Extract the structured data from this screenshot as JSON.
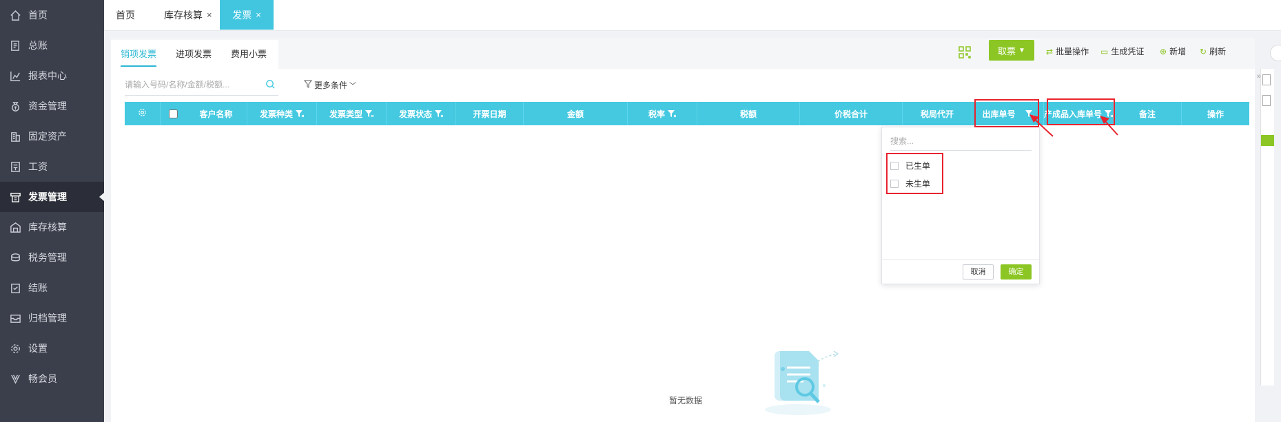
{
  "sidebar": {
    "items": [
      {
        "label": "首页",
        "icon": "home-icon"
      },
      {
        "label": "总账",
        "icon": "ledger-icon"
      },
      {
        "label": "报表中心",
        "icon": "chart-icon"
      },
      {
        "label": "资金管理",
        "icon": "money-bag-icon"
      },
      {
        "label": "固定资产",
        "icon": "building-icon"
      },
      {
        "label": "工资",
        "icon": "payroll-icon"
      },
      {
        "label": "发票管理",
        "icon": "invoice-icon"
      },
      {
        "label": "库存核算",
        "icon": "warehouse-icon"
      },
      {
        "label": "税务管理",
        "icon": "tax-icon"
      },
      {
        "label": "结账",
        "icon": "checkout-icon"
      },
      {
        "label": "归档管理",
        "icon": "archive-icon"
      },
      {
        "label": "设置",
        "icon": "gear-icon"
      },
      {
        "label": "畅会员",
        "icon": "vip-icon"
      }
    ],
    "active_index": 6
  },
  "tabs": [
    {
      "label": "首页"
    },
    {
      "label": "库存核算",
      "close": "×"
    },
    {
      "label": "发票",
      "close": "×"
    }
  ],
  "subtabs": [
    {
      "label": "销项发票"
    },
    {
      "label": "进项发票"
    },
    {
      "label": "费用小票"
    }
  ],
  "toolbar": {
    "fetch_label": "取票",
    "batch_label": "批量操作",
    "voucher_label": "生成凭证",
    "add_label": "新增",
    "refresh_label": "刷新"
  },
  "search": {
    "placeholder": "请输入号码/名称/金额/税额...",
    "more_filter": "更多条件"
  },
  "table": {
    "columns": [
      {
        "label": "客户名称"
      },
      {
        "label": "发票种类"
      },
      {
        "label": "发票类型"
      },
      {
        "label": "发票状态"
      },
      {
        "label": "开票日期"
      },
      {
        "label": "金额"
      },
      {
        "label": "税率"
      },
      {
        "label": "税额"
      },
      {
        "label": "价税合计"
      },
      {
        "label": "税局代开"
      },
      {
        "label": "出库单号"
      },
      {
        "label": "产成品入库单号"
      },
      {
        "label": "备注"
      },
      {
        "label": "操作"
      }
    ]
  },
  "dropdown": {
    "search_placeholder": "搜索...",
    "options": [
      "已生单",
      "未生单"
    ],
    "cancel_label": "取消",
    "ok_label": "确定"
  },
  "empty": {
    "text": "暂无数据"
  },
  "colors": {
    "accent": "#44c9e1",
    "green": "#8cc624",
    "sidebar_bg": "#3b3f4c",
    "annotation_red": "#e8232e"
  }
}
